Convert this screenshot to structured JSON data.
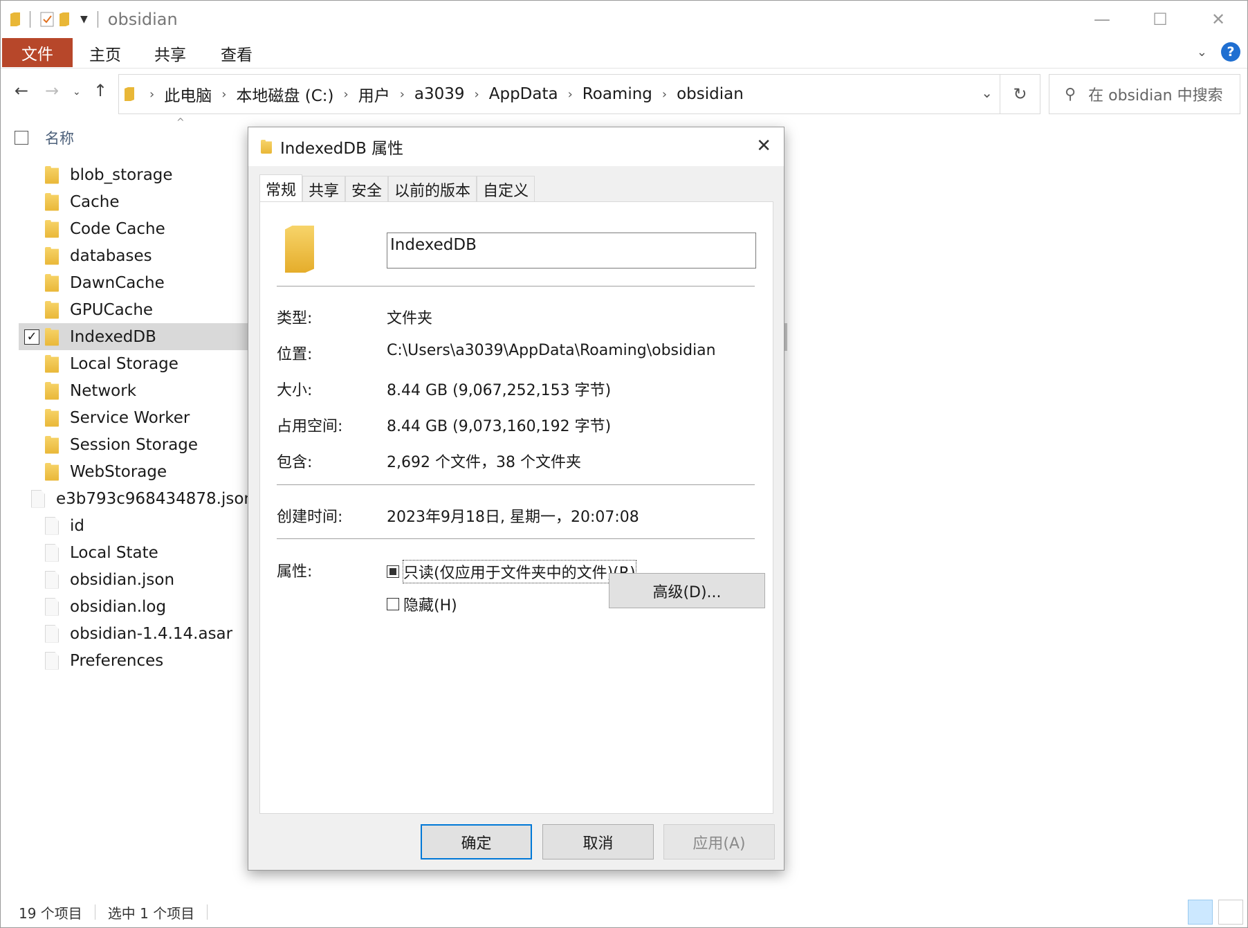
{
  "window": {
    "title": "obsidian",
    "controls": {
      "minimize": "—",
      "maximize": "☐",
      "close": "✕"
    }
  },
  "ribbon": {
    "tabs": [
      "文件",
      "主页",
      "共享",
      "查看"
    ]
  },
  "address": {
    "crumbs": [
      "此电脑",
      "本地磁盘 (C:)",
      "用户",
      "a3039",
      "AppData",
      "Roaming",
      "obsidian"
    ],
    "search_placeholder": "在 obsidian 中搜索"
  },
  "file_list": {
    "header_name": "名称",
    "items": [
      {
        "name": "blob_storage",
        "type": "folder"
      },
      {
        "name": "Cache",
        "type": "folder"
      },
      {
        "name": "Code Cache",
        "type": "folder"
      },
      {
        "name": "databases",
        "type": "folder"
      },
      {
        "name": "DawnCache",
        "type": "folder"
      },
      {
        "name": "GPUCache",
        "type": "folder"
      },
      {
        "name": "IndexedDB",
        "type": "folder",
        "selected": true
      },
      {
        "name": "Local Storage",
        "type": "folder"
      },
      {
        "name": "Network",
        "type": "folder"
      },
      {
        "name": "Service Worker",
        "type": "folder"
      },
      {
        "name": "Session Storage",
        "type": "folder"
      },
      {
        "name": "WebStorage",
        "type": "folder"
      },
      {
        "name": "e3b793c968434878.json",
        "type": "file"
      },
      {
        "name": "id",
        "type": "file"
      },
      {
        "name": "Local State",
        "type": "file"
      },
      {
        "name": "obsidian.json",
        "type": "file"
      },
      {
        "name": "obsidian.log",
        "type": "file"
      },
      {
        "name": "obsidian-1.4.14.asar",
        "type": "file"
      },
      {
        "name": "Preferences",
        "type": "file"
      }
    ]
  },
  "status": {
    "count": "19 个项目",
    "selected": "选中 1 个项目"
  },
  "dialog": {
    "title": "IndexedDB 属性",
    "tabs": [
      "常规",
      "共享",
      "安全",
      "以前的版本",
      "自定义"
    ],
    "name_value": "IndexedDB",
    "props": {
      "type_label": "类型:",
      "type_value": "文件夹",
      "location_label": "位置:",
      "location_value": "C:\\Users\\a3039\\AppData\\Roaming\\obsidian",
      "size_label": "大小:",
      "size_value": "8.44 GB (9,067,252,153 字节)",
      "disk_label": "占用空间:",
      "disk_value": "8.44 GB (9,073,160,192 字节)",
      "contains_label": "包含:",
      "contains_value": "2,692 个文件，38 个文件夹",
      "created_label": "创建时间:",
      "created_value": "2023年9月18日, 星期一，20:07:08",
      "attrs_label": "属性:"
    },
    "readonly_label": "只读(仅应用于文件夹中的文件)(R)",
    "hidden_label": "隐藏(H)",
    "advanced_label": "高级(D)...",
    "ok_label": "确定",
    "cancel_label": "取消",
    "apply_label": "应用(A)"
  },
  "colors": {
    "file_tab": "#b7472a",
    "accent": "#0078d7",
    "folder": "#e9b737"
  }
}
